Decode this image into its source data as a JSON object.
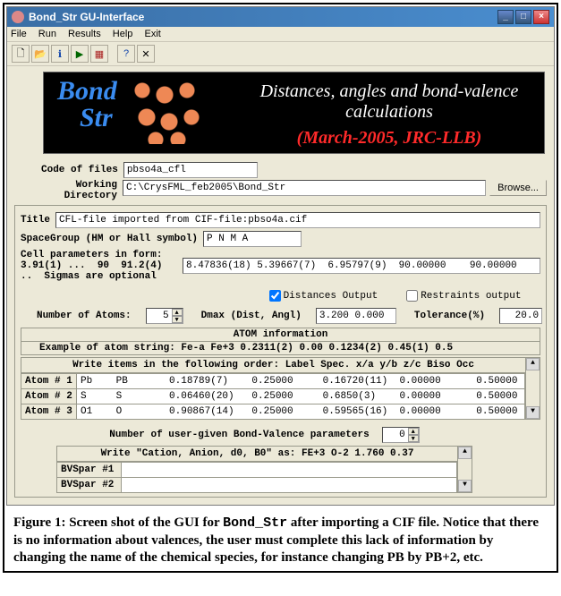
{
  "window_title": "Bond_Str GU-Interface",
  "menu": [
    "File",
    "Run",
    "Results",
    "Help",
    "Exit"
  ],
  "banner": {
    "logo1": "Bond",
    "logo2": "Str",
    "line1": "Distances, angles and bond-valence calculations",
    "line2": "(March-2005, JRC-LLB)"
  },
  "code_files": {
    "label": "Code of files",
    "value": "pbso4a_cfl"
  },
  "workdir": {
    "label": "Working\nDirectory",
    "value": "C:\\CrysFML_feb2005\\Bond_Str",
    "browse": "Browse..."
  },
  "title_field": {
    "label": "Title",
    "value": "CFL-file imported from CIF-file:pbso4a.cif"
  },
  "spacegroup": {
    "label": "SpaceGroup (HM or Hall symbol)",
    "value": "P N M A"
  },
  "cellparams": {
    "label": "Cell parameters in form:\n3.91(1) ...  90  91.2(4)\n..  Sigmas are optional",
    "value": "8.47836(18) 5.39667(7)  6.95797(9)  90.00000    90.00000    90.00000"
  },
  "checkboxes": {
    "distances": {
      "label": "Distances Output",
      "checked": true
    },
    "restraints": {
      "label": "Restraints output",
      "checked": false
    }
  },
  "atoms_count": {
    "label": "Number of Atoms:",
    "value": "5"
  },
  "dmax": {
    "label": "Dmax (Dist, Angl)",
    "value": "3.200 0.000"
  },
  "tolerance": {
    "label": "Tolerance(%)",
    "value": "20.0"
  },
  "atom_info": {
    "heading": "ATOM  information",
    "example": "Example of atom string:    Fe-a    Fe+3   0.2311(2)   0.00   0.1234(2)   0.45(1)   0.5"
  },
  "atom_grid": {
    "header": "Write items in the following order: Label  Spec.   x/a    y/b   z/c   Biso   Occ",
    "rows": [
      {
        "label": "Atom # 1",
        "data": "Pb    PB       0.18789(7)    0.25000     0.16720(11)  0.00000      0.50000"
      },
      {
        "label": "Atom # 2",
        "data": "S     S        0.06460(20)   0.25000     0.6850(3)    0.00000      0.50000"
      },
      {
        "label": "Atom # 3",
        "data": "O1    O        0.90867(14)   0.25000     0.59565(16)  0.00000      0.50000"
      }
    ]
  },
  "bv": {
    "count_label": "Number of user-given Bond-Valence parameters",
    "count_value": "0",
    "header": "Write \"Cation, Anion, d0, B0\" as: FE+3 O-2 1.760 0.37",
    "rows": [
      {
        "label": "BVSpar #1",
        "data": ""
      },
      {
        "label": "BVSpar #2",
        "data": ""
      }
    ]
  },
  "caption": {
    "prefix": "Figure 1: Screen shot of the GUI for ",
    "code": "Bond_Str",
    "suffix": " after importing a CIF file. Notice that there is no information about valences, the user must complete this lack of information by changing the name of the chemical species, for instance changing PB by PB+2, etc."
  }
}
